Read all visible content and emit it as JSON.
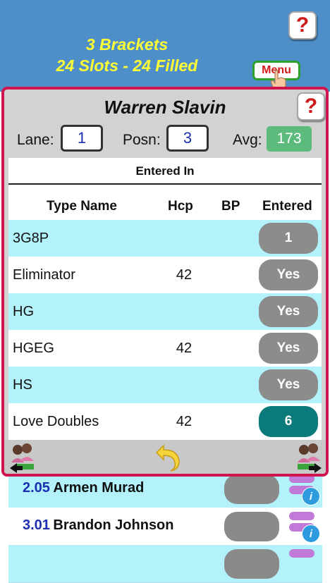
{
  "header": {
    "line1": "3 Brackets",
    "line2": "24 Slots  -  24 Filled",
    "help_label": "?",
    "menu_label": "Menu"
  },
  "dialog": {
    "title": "Warren Slavin",
    "help_label": "?",
    "lane_label": "Lane:",
    "lane_value": "1",
    "posn_label": "Posn:",
    "posn_value": "3",
    "avg_label": "Avg:",
    "avg_value": "173",
    "section_title": "Entered In",
    "columns": [
      "Type Name",
      "Hcp",
      "BP",
      "Entered"
    ],
    "rows": [
      {
        "name": "3G8P",
        "hcp": "",
        "bp": "",
        "entered": "1",
        "highlight": false
      },
      {
        "name": "Eliminator",
        "hcp": "42",
        "bp": "",
        "entered": "Yes",
        "highlight": false
      },
      {
        "name": "HG",
        "hcp": "",
        "bp": "",
        "entered": "Yes",
        "highlight": false
      },
      {
        "name": "HGEG",
        "hcp": "42",
        "bp": "",
        "entered": "Yes",
        "highlight": false
      },
      {
        "name": "HS",
        "hcp": "",
        "bp": "",
        "entered": "Yes",
        "highlight": false
      },
      {
        "name": "Love Doubles",
        "hcp": "42",
        "bp": "",
        "entered": "6",
        "highlight": true
      }
    ]
  },
  "background_list": [
    {
      "num": "2.05",
      "name": "Armen Murad"
    },
    {
      "num": "3.01",
      "name": "Brandon Johnson"
    }
  ],
  "colors": {
    "accent_red": "#d0144e",
    "header_blue": "#4f8fc9",
    "row_cyan": "#b3f2fb",
    "pill_gray": "#8c8c8c",
    "pill_teal": "#0b7a7a",
    "avg_green": "#5cba7d"
  },
  "icons": {
    "prev": "bowlers-prev-icon",
    "back": "undo-arrow-icon",
    "next": "bowlers-next-icon",
    "info": "info-icon"
  }
}
